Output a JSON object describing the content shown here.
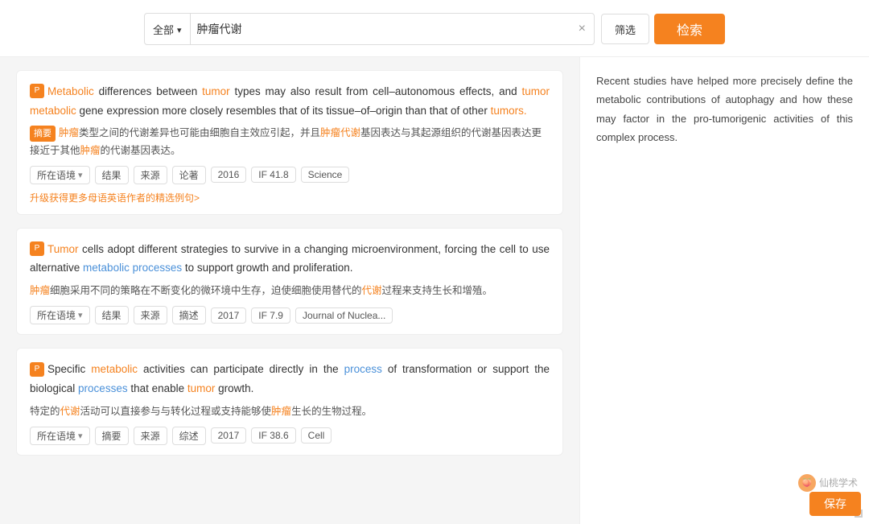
{
  "search": {
    "category_label": "全部",
    "query": "肿瘤代谢",
    "filter_label": "筛选",
    "search_label": "检索",
    "clear_icon": "×"
  },
  "results": [
    {
      "id": 1,
      "icon_text": "P",
      "text_en_parts": [
        {
          "text": "Metabolic",
          "type": "orange"
        },
        {
          "text": " differences between ",
          "type": "normal"
        },
        {
          "text": "tumor",
          "type": "orange"
        },
        {
          "text": " types may also result from cell–autonomous effects, and ",
          "type": "normal"
        },
        {
          "text": "tumor metabolic",
          "type": "orange"
        },
        {
          "text": " gene expression more closely resembles that of its tissue–of–origin than that of other ",
          "type": "normal"
        },
        {
          "text": "tumors.",
          "type": "orange"
        }
      ],
      "badge": "摘要",
      "text_zh": "肿瘤类型之间的代谢差异也可能由细胞自主效应引起，并且肿瘤代谢基因表达与其起源组织的代谢基因表达更接近于其他肿瘤的代谢基因表达。",
      "text_zh_highlights": [
        "肿瘤",
        "肿瘤代谢",
        "肿瘤"
      ],
      "tags": [
        "所在语境",
        "结果",
        "来源",
        "论著",
        "2016",
        "IF 41.8",
        "Science"
      ],
      "upgrade_link": "升级获得更多母语英语作者的精选例句>"
    },
    {
      "id": 2,
      "icon_text": "P",
      "text_en_parts": [
        {
          "text": "Tumor",
          "type": "orange"
        },
        {
          "text": " cells adopt different strategies to survive in a changing microenvironment, forcing the cell to use alternative ",
          "type": "normal"
        },
        {
          "text": "metabolic processes",
          "type": "blue"
        },
        {
          "text": " to support growth and proliferation.",
          "type": "normal"
        }
      ],
      "badge": null,
      "text_zh": "肿瘤细胞采用不同的策略在不断变化的微环境中生存，迫使细胞使用替代的代谢过程来支持生长和增殖。",
      "text_zh_highlights": [
        "肿瘤",
        "代谢"
      ],
      "tags": [
        "所在语境",
        "结果",
        "来源",
        "摘述",
        "2017",
        "IF 7.9",
        "Journal of Nuclea..."
      ],
      "upgrade_link": null
    },
    {
      "id": 3,
      "icon_text": "P",
      "text_en_parts": [
        {
          "text": "Specific ",
          "type": "normal"
        },
        {
          "text": "metabolic",
          "type": "orange"
        },
        {
          "text": " activities can participate directly in the ",
          "type": "normal"
        },
        {
          "text": "process",
          "type": "blue"
        },
        {
          "text": " of transformation or support the biological ",
          "type": "normal"
        },
        {
          "text": "processes",
          "type": "blue"
        },
        {
          "text": " that enable ",
          "type": "normal"
        },
        {
          "text": "tumor",
          "type": "orange"
        },
        {
          "text": " growth.",
          "type": "normal"
        }
      ],
      "badge": null,
      "text_zh": "特定的代谢活动可以直接参与与转化过程或支持能够使肿瘤生长的生物过程。",
      "text_zh_highlights": [
        "代谢",
        "肿瘤"
      ],
      "tags": [
        "所在语境",
        "摘要",
        "来源",
        "综述",
        "2017",
        "IF 38.6",
        "Cell"
      ],
      "upgrade_link": null
    }
  ],
  "right_panel": {
    "text": "Recent studies have helped more precisely define the metabolic contributions of autophagy and how these may factor in the pro-tumorigenic activities of this complex process."
  },
  "watermark": {
    "text": "仙桃学术"
  },
  "save_button": {
    "label": "保存"
  }
}
